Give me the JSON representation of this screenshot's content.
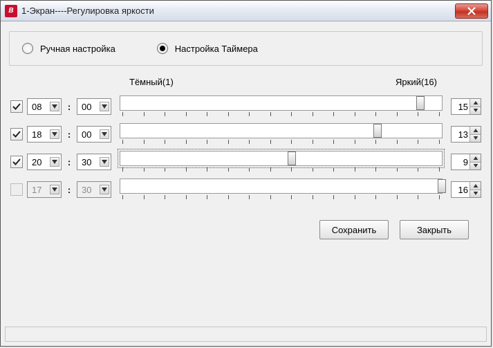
{
  "window": {
    "title": "1-Экран----Регулировка яркости"
  },
  "mode": {
    "manual_label": "Ручная настройка",
    "timer_label": "Настройка Таймера",
    "selected": "timer"
  },
  "labels": {
    "dark": "Тёмный(1)",
    "bright": "Яркий(16)"
  },
  "slider": {
    "min": 1,
    "max": 16
  },
  "rows": [
    {
      "enabled": true,
      "hour": "08",
      "minute": "00",
      "value": 15,
      "focused": false
    },
    {
      "enabled": true,
      "hour": "18",
      "minute": "00",
      "value": 13,
      "focused": false
    },
    {
      "enabled": true,
      "hour": "20",
      "minute": "30",
      "value": 9,
      "focused": true
    },
    {
      "enabled": false,
      "hour": "17",
      "minute": "30",
      "value": 16,
      "focused": false
    }
  ],
  "buttons": {
    "save": "Сохранить",
    "close": "Закрыть"
  }
}
